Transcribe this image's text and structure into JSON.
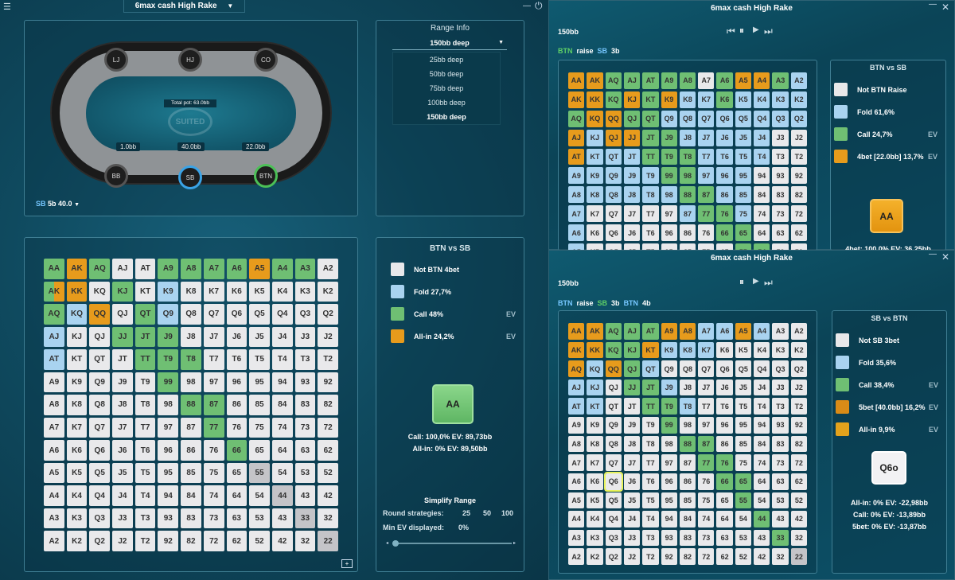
{
  "main": {
    "menu_icon": "menu-icon",
    "title": "6max cash High Rake"
  },
  "table": {
    "total_pot": "Total pot: 63.0bb",
    "logo": "SUITED",
    "stacks": {
      "left": "1.0bb",
      "center": "40.0bb",
      "right": "22.0bb"
    },
    "seats": [
      "LJ",
      "HJ",
      "CO",
      "BB",
      "SB",
      "BTN"
    ],
    "selector_pos": "SB",
    "selector_val": "5b 40.0"
  },
  "range_info": {
    "title": "Range Info",
    "selected": "150bb deep",
    "options": [
      "25bb deep",
      "50bb deep",
      "75bb deep",
      "100bb deep",
      "150bb deep"
    ]
  },
  "left_grid": {
    "title": "BTN vs SB",
    "legend": [
      {
        "label": "Not BTN 4bet",
        "color": "#e8e8ea",
        "ev": ""
      },
      {
        "label": "Fold 27,7%",
        "color": "#a9d3f0",
        "ev": ""
      },
      {
        "label": "Call 48%",
        "color": "#6fbf73",
        "ev": "EV"
      },
      {
        "label": "All-in 24,2%",
        "color": "#e79b1c",
        "ev": "EV"
      }
    ],
    "combo": "AA",
    "line1": "Call: 100,0% EV: 89,73bb",
    "line2": "All-in: 0% EV: 89,50bb",
    "simplify": {
      "title": "Simplify Range",
      "round_label": "Round strategies:",
      "round_opts": [
        "25",
        "50",
        "100"
      ],
      "minev_label": "Min EV displayed:",
      "minev_val": "0%"
    },
    "cells": "AA:G|AK:O|AQ:G|AJ:W|AT:W|A9:G|A8:G|A7:G|A6:G|A5:O|A4:G|A3:G|A2:W|AK:G,O|KK:O|KQ:W|KJ:G|KT:W|K9:B|K8:W|K7:W|K6:W|K5:W|K4:W|K3:W|K2:W|AQ:G|KQ:B|QQ:O|QJ:W|QT:G|Q9:B|Q8:W|Q7:W|Q6:W|Q5:W|Q4:W|Q3:W|Q2:W|AJ:B|KJ:W|QJ:W|JJ:G|JT:G|J9:G|J8:W|J7:W|J6:W|J5:W|J4:W|J3:W|J2:W|AT:B|KT:W|QT:W|JT:W|TT:G|T9:G|T8:G|T7:W|T6:W|T5:W|T4:W|T3:W|T2:W|A9:W|K9:W|Q9:W|J9:W|T9:W|99:G|98:W|97:W|96:W|95:W|94:W|93:W|92:W|A8:W|K8:W|Q8:W|J8:W|T8:W|98:W|88:G|87:G|86:W|85:W|84:W|83:W|82:W|A7:W|K7:W|Q7:W|J7:W|T7:W|97:W|87:W|77:G|76:W|75:W|74:W|73:W|72:W|A6:W|K6:W|Q6:W|J6:W|T6:W|96:W|86:W|76:W|66:G|65:W|64:W|63:W|62:W|A5:W|K5:W|Q5:W|J5:W|T5:W|95:W|85:W|75:W|65:W|55:D|54:W|53:W|52:W|A4:W|K4:W|Q4:W|J4:W|T4:W|94:W|84:W|74:W|64:W|54:W|44:D|43:W|42:W|A3:W|K3:W|Q3:W|J3:W|T3:W|93:W|83:W|73:W|63:W|53:W|43:W|33:D|32:W|A2:W|K2:W|Q2:W|J2:W|T2:W|92:W|82:W|72:W|62:W|52:W|42:W|32:W|22:D",
    "add_icon": "add-screen-icon"
  },
  "win1": {
    "title": "6max cash High Rake",
    "stack": "150bb",
    "path": [
      {
        "t": "BTN",
        "c": "#5fd067"
      },
      {
        "t": "raise",
        "c": "#fff"
      },
      {
        "t": "SB",
        "c": "#76c7ff"
      },
      {
        "t": "3b",
        "c": "#fff"
      }
    ],
    "legend_title": "BTN vs SB",
    "legend": [
      {
        "label": "Not BTN Raise",
        "color": "#e8e8ea",
        "ev": ""
      },
      {
        "label": "Fold 61,6%",
        "color": "#a9d3f0",
        "ev": ""
      },
      {
        "label": "Call 24,7%",
        "color": "#6fbf73",
        "ev": "EV"
      },
      {
        "label": "4bet [22.0bb] 13,7%",
        "color": "#e79b1c",
        "ev": "EV"
      }
    ],
    "combo": "AA",
    "line1": "4bet: 100,0% EV: 36,25bb",
    "cells": "AA:O|AK:O|AQ:G|AJ:G|AT:G|A9:G|A8:G|A7:W|A6:G|A5:O|A4:O|A3:G|A2:B|AK:O|KK:O|KQ:G|KJ:O|KT:G|K9:O|K8:B|K7:B|K6:G|K5:B|K4:B|K3:B|K2:B|AQ:G|KQ:O|QQ:O|QJ:G|QT:G|Q9:B|Q8:B|Q7:B|Q6:B|Q5:B|Q4:B|Q3:B|Q2:B|AJ:O|KJ:B|QJ:O|JJ:O|JT:G|J9:G|J8:B|J7:B|J6:B|J5:B|J4:B|J3:W|J2:W|AT:O|KT:B|QT:B|JT:B|TT:G|T9:G|T8:G|T7:B|T6:B|T5:B|T4:B|T3:W|T2:W|A9:B|K9:B|Q9:B|J9:B|T9:B|99:G|98:G|97:B|96:B|95:B|94:W|93:W|92:W|A8:B|K8:B|Q8:B|J8:B|T8:B|98:B|88:G|87:G|86:B|85:B|84:W|83:W|82:W|A7:B|K7:W|Q7:W|J7:W|T7:W|97:W|87:B|77:G|76:G|75:B|74:W|73:W|72:W|A6:B|K6:W|Q6:W|J6:W|T6:W|96:W|86:W|76:W|66:G|65:G|64:W|63:W|62:W|A5:B|K5:W|Q5:W|J5:W|T5:W|95:W|85:W|75:W|65:W|55:G|54:G|53:W|52:W"
  },
  "win2": {
    "title": "6max cash High Rake",
    "stack": "150bb",
    "path": [
      {
        "t": "BTN",
        "c": "#76c7ff"
      },
      {
        "t": "raise",
        "c": "#fff"
      },
      {
        "t": "SB",
        "c": "#5fd067"
      },
      {
        "t": "3b",
        "c": "#fff"
      },
      {
        "t": "BTN",
        "c": "#76c7ff"
      },
      {
        "t": "4b",
        "c": "#fff"
      }
    ],
    "legend_title": "SB vs BTN",
    "legend": [
      {
        "label": "Not SB 3bet",
        "color": "#e8e8ea",
        "ev": ""
      },
      {
        "label": "Fold 35,6%",
        "color": "#a9d3f0",
        "ev": ""
      },
      {
        "label": "Call 38,4%",
        "color": "#6fbf73",
        "ev": "EV"
      },
      {
        "label": "5bet [40.0bb] 16,2%",
        "color": "#d98b17",
        "ev": "EV"
      },
      {
        "label": "All-in 9,9%",
        "color": "#e3a21c",
        "ev": "EV"
      }
    ],
    "combo": "Q6o",
    "line1": "All-in: 0% EV: -22,98bb",
    "line2": "Call: 0% EV: -13,89bb",
    "line3": "5bet: 0% EV: -13,87bb",
    "cells": "AA:O|AK:O|AQ:G|AJ:G|AT:G|A9:O|A8:O|A7:B|A6:B|A5:O|A4:B|A3:W|A2:W|AK:O|KK:O|KQ:G|KJ:G|KT:O|K9:B|K8:B|K7:B|K6:W|K5:W|K4:W|K3:W|K2:W|AQ:O|KQ:B|QQ:O|QJ:G|QT:B|Q9:W|Q8:W|Q7:W|Q6:W|Q5:W|Q4:W|Q3:W|Q2:W|AJ:B|KJ:B|QJ:W|JJ:G|JT:G|J9:B|J8:W|J7:W|J6:W|J5:W|J4:W|J3:W|J2:W|AT:B|KT:B|QT:W|JT:W|TT:G|T9:G|T8:B|T7:W|T6:W|T5:W|T4:W|T3:W|T2:W|A9:W|K9:W|Q9:W|J9:W|T9:W|99:G|98:W|97:W|96:W|95:W|94:W|93:W|92:W|A8:W|K8:W|Q8:W|J8:W|T8:W|98:W|88:G|87:G|86:W|85:W|84:W|83:W|82:W|A7:W|K7:W|Q7:W|J7:W|T7:W|97:W|87:W|77:G|76:G|75:W|74:W|73:W|72:W|A6:W|K6:W|Q6:S|J6:W|T6:W|96:W|86:W|76:W|66:G|65:G|64:W|63:W|62:W|A5:W|K5:W|Q5:W|J5:W|T5:W|95:W|85:W|75:W|65:W|55:G|54:W|53:W|52:W|A4:W|K4:W|Q4:W|J4:W|T4:W|94:W|84:W|74:W|64:W|54:W|44:G|43:W|42:W|A3:W|K3:W|Q3:W|J3:W|T3:W|93:W|83:W|73:W|63:W|53:W|43:W|33:G|32:W|A2:W|K2:W|Q2:W|J2:W|T2:W|92:W|82:W|72:W|62:W|52:W|42:W|32:W|22:D"
  },
  "controls": {
    "first": "⏮",
    "pause": "⏸",
    "next": "▶",
    "last": "⏭",
    "minimize": "—",
    "power": "⏻",
    "close": "✕"
  },
  "colors": {
    "W": "#e9e9eb",
    "B": "#a9d3f0",
    "G": "#6fbf73",
    "O": "#e79b1c",
    "D": "#c4c4c8"
  }
}
